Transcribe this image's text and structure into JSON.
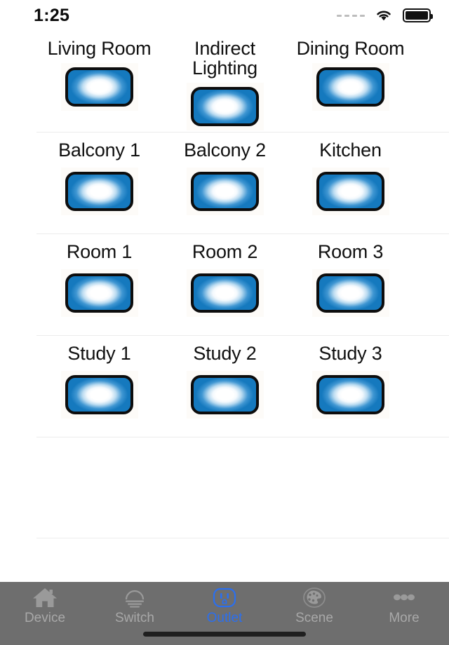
{
  "status_bar": {
    "time": "1:25",
    "signal_icon": "signal-dots-icon",
    "wifi_icon": "wifi-icon",
    "battery_icon": "battery-full-icon"
  },
  "accent_color": "#2a6ff0",
  "outlet_color": "#1579be",
  "tabbar_bg": "#6e6e6e",
  "list": {
    "rows": [
      {
        "cells": [
          {
            "label": "Living Room",
            "icon": "outlet-icon",
            "state": "on"
          },
          {
            "label": "Indirect Lighting",
            "icon": "outlet-icon",
            "state": "on"
          },
          {
            "label": "Dining Room",
            "icon": "outlet-icon",
            "state": "on"
          }
        ]
      },
      {
        "cells": [
          {
            "label": "Balcony 1",
            "icon": "outlet-icon",
            "state": "on"
          },
          {
            "label": "Balcony 2",
            "icon": "outlet-icon",
            "state": "on"
          },
          {
            "label": "Kitchen",
            "icon": "outlet-icon",
            "state": "on"
          }
        ]
      },
      {
        "cells": [
          {
            "label": "Room 1",
            "icon": "outlet-icon",
            "state": "on"
          },
          {
            "label": "Room 2",
            "icon": "outlet-icon",
            "state": "on"
          },
          {
            "label": "Room 3",
            "icon": "outlet-icon",
            "state": "on"
          }
        ]
      },
      {
        "cells": [
          {
            "label": "Study 1",
            "icon": "outlet-icon",
            "state": "on"
          },
          {
            "label": "Study 2",
            "icon": "outlet-icon",
            "state": "on"
          },
          {
            "label": "Study 3",
            "icon": "outlet-icon",
            "state": "on"
          }
        ]
      },
      {
        "cells": []
      }
    ]
  },
  "tabbar": {
    "items": [
      {
        "label": "Device",
        "icon": "home-icon",
        "active": false
      },
      {
        "label": "Switch",
        "icon": "lamp-icon",
        "active": false
      },
      {
        "label": "Outlet",
        "icon": "outlet-icon",
        "active": true
      },
      {
        "label": "Scene",
        "icon": "palette-icon",
        "active": false
      },
      {
        "label": "More",
        "icon": "ellipsis-icon",
        "active": false
      }
    ]
  }
}
